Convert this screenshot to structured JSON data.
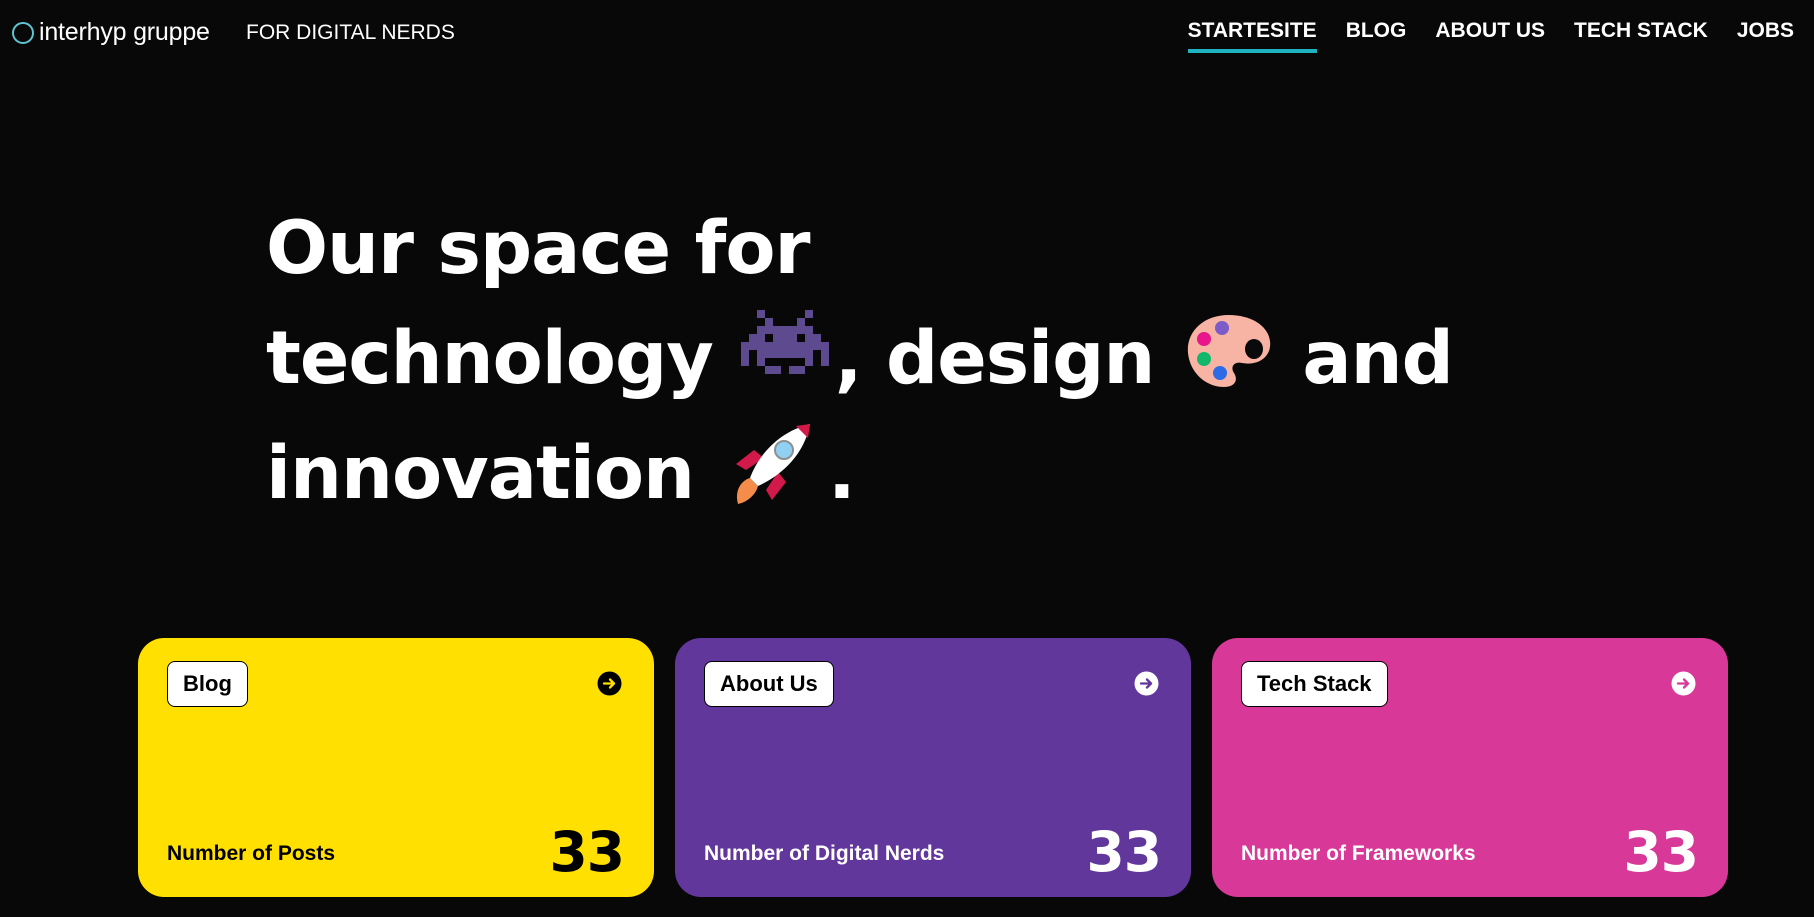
{
  "header": {
    "brand_name": "interhyp gruppe",
    "tagline": "FOR DIGITAL NERDS",
    "nav": [
      {
        "label": "STARTESITE",
        "active": true
      },
      {
        "label": "BLOG",
        "active": false
      },
      {
        "label": "ABOUT US",
        "active": false
      },
      {
        "label": "TECH STACK",
        "active": false
      },
      {
        "label": "JOBS",
        "active": false
      }
    ],
    "nav_accent": "#1fb3bf"
  },
  "hero": {
    "line1": "Our space for",
    "line2_a": "technology",
    "line2_b": ", design",
    "line2_c": "and",
    "line3_a": "innovation",
    "line3_b": ".",
    "emojis": [
      "space-invader-icon",
      "artist-palette-icon",
      "rocket-icon"
    ]
  },
  "cards": [
    {
      "tag": "Blog",
      "label": "Number of Posts",
      "count": "33",
      "bg": "#ffe000",
      "fg": "#000000"
    },
    {
      "tag": "About Us",
      "label": "Number of Digital Nerds",
      "count": "33",
      "bg": "#62379c",
      "fg": "#ffffff"
    },
    {
      "tag": "Tech Stack",
      "label": "Number of Frameworks",
      "count": "33",
      "bg": "#d83897",
      "fg": "#ffffff"
    }
  ]
}
